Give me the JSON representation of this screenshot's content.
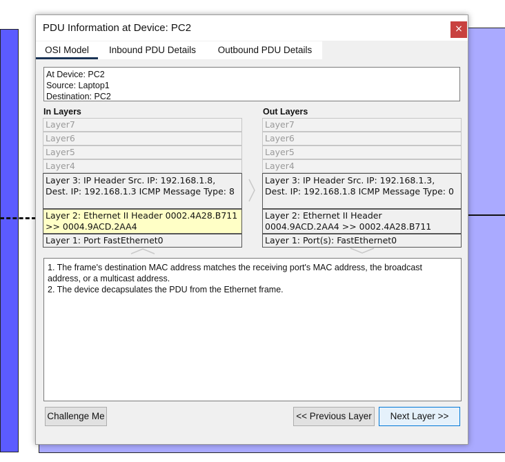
{
  "window": {
    "title": "PDU Information at Device: PC2",
    "close_glyph": "×"
  },
  "tabs": [
    {
      "label": "OSI Model",
      "active": true
    },
    {
      "label": "Inbound PDU Details",
      "active": false
    },
    {
      "label": "Outbound PDU Details",
      "active": false
    }
  ],
  "device_info": {
    "device": "At Device: PC2",
    "source": "Source: Laptop1",
    "destination": "Destination: PC2"
  },
  "in_layers": {
    "heading": "In Layers",
    "layer7": "Layer7",
    "layer6": "Layer6",
    "layer5": "Layer5",
    "layer4": "Layer4",
    "layer3": "Layer 3: IP Header Src. IP: 192.168.1.8, Dest. IP: 192.168.1.3 ICMP Message Type: 8",
    "layer2": "Layer 2: Ethernet II Header 0002.4A28.B711 >> 0004.9ACD.2AA4",
    "layer1": "Layer 1: Port FastEthernet0"
  },
  "out_layers": {
    "heading": "Out Layers",
    "layer7": "Layer7",
    "layer6": "Layer6",
    "layer5": "Layer5",
    "layer4": "Layer4",
    "layer3": "Layer 3: IP Header Src. IP: 192.168.1.3, Dest. IP: 192.168.1.8 ICMP Message Type: 0",
    "layer2": "Layer 2: Ethernet II Header 0004.9ACD.2AA4 >> 0002.4A28.B711",
    "layer1": "Layer 1: Port(s): FastEthernet0"
  },
  "explanation": [
    "1. The frame's destination MAC address matches the receiving port's MAC address, the broadcast address, or a multicast address.",
    "2. The device decapsulates the PDU from the Ethernet frame."
  ],
  "buttons": {
    "challenge": "Challenge Me",
    "previous": "<< Previous Layer",
    "next": "Next Layer >>"
  },
  "colors": {
    "highlight_layer": "#ffffc6",
    "close_button": "#c8413f",
    "left_device_fill": "#5b5bff",
    "right_device_fill": "#aaaaff"
  }
}
